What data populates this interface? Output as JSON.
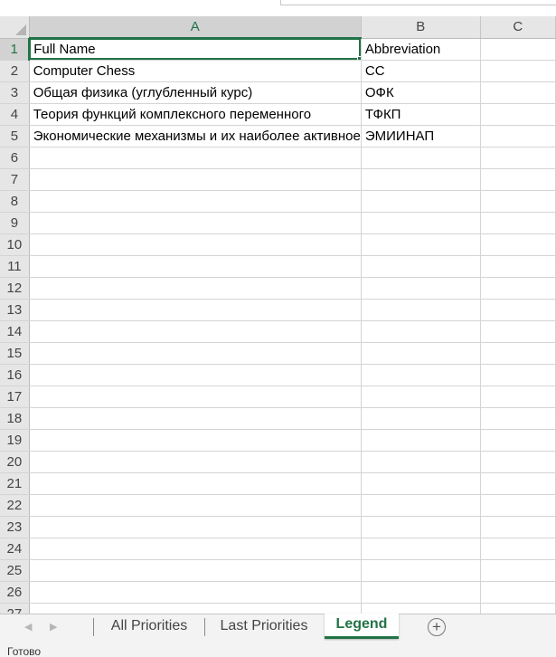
{
  "columns": [
    "A",
    "B",
    "C"
  ],
  "rows": [
    {
      "num": "1",
      "a": "Full Name",
      "b": "Abbreviation"
    },
    {
      "num": "2",
      "a": "Computer Chess",
      "b": "CC"
    },
    {
      "num": "3",
      "a": "Общая физика (углубленный курс)",
      "b": "ОФК"
    },
    {
      "num": "4",
      "a": "Теория функций комплексного переменного",
      "b": "ТФКП"
    },
    {
      "num": "5",
      "a": "Экономические механизмы и их наиболее активное",
      "b": "ЭМИИНАП"
    },
    {
      "num": "6",
      "a": "",
      "b": ""
    },
    {
      "num": "7",
      "a": "",
      "b": ""
    },
    {
      "num": "8",
      "a": "",
      "b": ""
    },
    {
      "num": "9",
      "a": "",
      "b": ""
    },
    {
      "num": "10",
      "a": "",
      "b": ""
    },
    {
      "num": "11",
      "a": "",
      "b": ""
    },
    {
      "num": "12",
      "a": "",
      "b": ""
    },
    {
      "num": "13",
      "a": "",
      "b": ""
    },
    {
      "num": "14",
      "a": "",
      "b": ""
    },
    {
      "num": "15",
      "a": "",
      "b": ""
    },
    {
      "num": "16",
      "a": "",
      "b": ""
    },
    {
      "num": "17",
      "a": "",
      "b": ""
    },
    {
      "num": "18",
      "a": "",
      "b": ""
    },
    {
      "num": "19",
      "a": "",
      "b": ""
    },
    {
      "num": "20",
      "a": "",
      "b": ""
    },
    {
      "num": "21",
      "a": "",
      "b": ""
    },
    {
      "num": "22",
      "a": "",
      "b": ""
    },
    {
      "num": "23",
      "a": "",
      "b": ""
    },
    {
      "num": "24",
      "a": "",
      "b": ""
    },
    {
      "num": "25",
      "a": "",
      "b": ""
    },
    {
      "num": "26",
      "a": "",
      "b": ""
    },
    {
      "num": "27",
      "a": "",
      "b": ""
    }
  ],
  "tabs": [
    {
      "label": "All Priorities",
      "active": false
    },
    {
      "label": "Last Priorities",
      "active": false
    },
    {
      "label": "Legend",
      "active": true
    }
  ],
  "add_sheet_icon": "plus-circle-icon",
  "status": "Готово",
  "colors": {
    "accent": "#217346"
  }
}
